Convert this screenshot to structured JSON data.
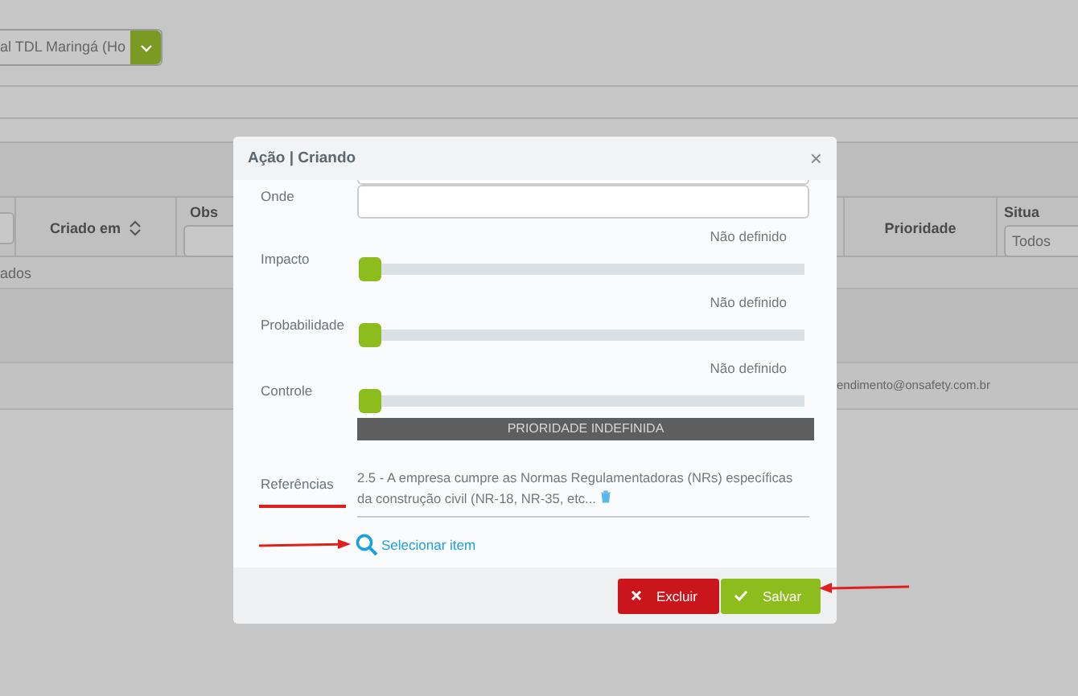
{
  "background": {
    "unit_select": {
      "value": "al TDL Maringá (Ho"
    },
    "table": {
      "columns": [
        {
          "filter_field": true
        },
        {
          "label": "Criado em",
          "sortable": true
        },
        {
          "label": "Obs",
          "filter_field": true
        },
        {
          "label": "Prioridade"
        },
        {
          "label": "Situa",
          "filter": "Todos"
        }
      ],
      "row_text": "ados"
    },
    "footer_email": "endimento@onsafety.com.br"
  },
  "dialog": {
    "title": "Ação | Criando",
    "close": "×",
    "fields": [
      {
        "kind": "text",
        "label": "Onde"
      },
      {
        "kind": "slider",
        "reading": "Não definido",
        "label": "Impacto",
        "level": 0
      },
      {
        "kind": "slider",
        "reading": "Não definido",
        "label": "Probabilidade",
        "level": 0
      },
      {
        "kind": "slider",
        "reading": "Não definido",
        "label": "Controle",
        "level": 0
      }
    ],
    "priority": "PRIORIDADE INDEFINIDA",
    "references": {
      "label": "Referências",
      "label_underlined": true,
      "text": "2.5 - A empresa cumpre as Normas Regulamentadoras (NRs) específicas da construção civil (NR-18, NR-35, etc...",
      "select_link": "Selecionar item",
      "link_arrow": true
    },
    "buttons": [
      {
        "label": "Excluir",
        "kind": "danger",
        "arrow": false
      },
      {
        "label": "Salvar",
        "kind": "primary",
        "arrow": true
      }
    ]
  }
}
